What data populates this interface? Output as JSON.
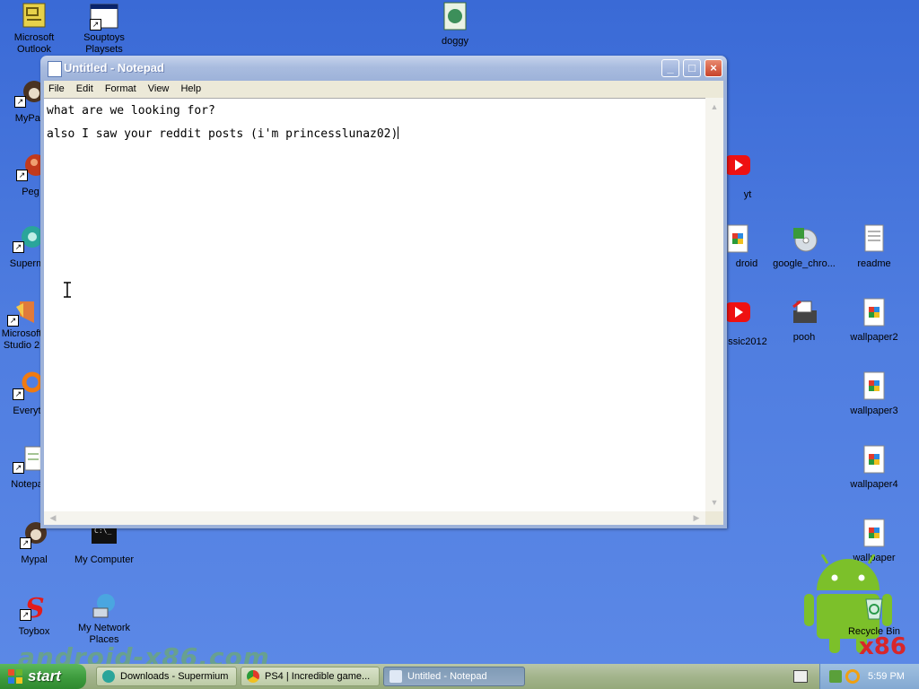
{
  "desktop": {
    "watermark": "android-x86.com",
    "icons_left": [
      {
        "label": "Microsoft Outlook",
        "icon": "outlook-icon"
      },
      {
        "label": "Souptoys Playsets",
        "icon": "window-icon"
      },
      {
        "label": "doggy",
        "icon": "image-icon"
      },
      {
        "label": "MyPal",
        "icon": "mypal-icon"
      },
      {
        "label": "Peg",
        "icon": "peg-icon"
      },
      {
        "label": "Superm",
        "icon": "supermium-icon"
      },
      {
        "label": "Microsoft Studio 2",
        "icon": "studio-icon"
      },
      {
        "label": "Everyt",
        "icon": "everything-icon"
      },
      {
        "label": "Notepa",
        "icon": "notepad-icon"
      },
      {
        "label": "Mypal",
        "icon": "mypal-icon"
      },
      {
        "label": "My Computer",
        "icon": "console-icon"
      },
      {
        "label": "Toybox",
        "icon": "toybox-icon"
      },
      {
        "label": "My Network Places",
        "icon": "network-icon"
      }
    ],
    "icons_right": [
      {
        "label": "yt",
        "icon": "youtube-icon"
      },
      {
        "label": "droid",
        "icon": "document-icon"
      },
      {
        "label": "google_chro...",
        "icon": "cd-icon"
      },
      {
        "label": "readme",
        "icon": "text-file-icon"
      },
      {
        "label": "ssic2012",
        "icon": "youtube-icon"
      },
      {
        "label": "pooh",
        "icon": "fax-icon"
      },
      {
        "label": "wallpaper2",
        "icon": "image-file-icon"
      },
      {
        "label": "wallpaper3",
        "icon": "image-file-icon"
      },
      {
        "label": "wallpaper4",
        "icon": "image-file-icon"
      },
      {
        "label": "wallpaper",
        "icon": "image-file-icon"
      },
      {
        "label": "Recycle Bin",
        "icon": "recycle-bin-icon"
      }
    ],
    "brand": "x86",
    "colors": {
      "background": "#4f7de0",
      "taskbar": "#a3b48c",
      "start": "#3d9b3d"
    }
  },
  "notepad": {
    "title": "Untitled - Notepad",
    "menu": [
      "File",
      "Edit",
      "Format",
      "View",
      "Help"
    ],
    "text_line1": "what are we looking for?",
    "text_line2": "also I saw your reddit posts (i'm princesslunaz02)",
    "controls": {
      "minimize": "_",
      "maximize": "□",
      "close": "×"
    }
  },
  "taskbar": {
    "start_label": "start",
    "tasks": [
      {
        "label": "Downloads - Supermium",
        "active": false
      },
      {
        "label": "PS4 | Incredible game...",
        "active": false
      },
      {
        "label": "Untitled - Notepad",
        "active": true
      }
    ],
    "clock": "5:59 PM"
  }
}
